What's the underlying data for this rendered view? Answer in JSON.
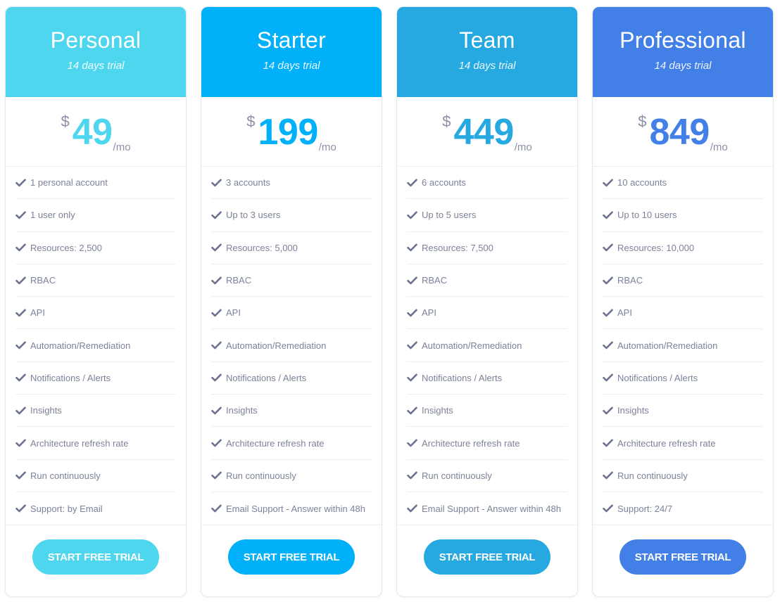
{
  "plans": [
    {
      "name": "Personal",
      "trial": "14 days trial",
      "currency": "$",
      "price": "49",
      "period": "/mo",
      "color": "#4dd6ee",
      "features": [
        "1 personal account",
        "1 user only",
        "Resources: 2,500",
        "RBAC",
        "API",
        "Automation/Remediation",
        "Notifications / Alerts",
        "Insights",
        "Architecture refresh rate",
        "Run continuously",
        "Support: by Email"
      ],
      "cta": "START FREE TRIAL"
    },
    {
      "name": "Starter",
      "trial": "14 days trial",
      "currency": "$",
      "price": "199",
      "period": "/mo",
      "color": "#00b0f8",
      "features": [
        "3 accounts",
        "Up to 3 users",
        "Resources: 5,000",
        "RBAC",
        "API",
        "Automation/Remediation",
        "Notifications / Alerts",
        "Insights",
        "Architecture refresh rate",
        "Run continuously",
        "Email Support - Answer within 48h"
      ],
      "cta": "START FREE TRIAL"
    },
    {
      "name": "Team",
      "trial": "14 days trial",
      "currency": "$",
      "price": "449",
      "period": "/mo",
      "color": "#26a8e0",
      "features": [
        "6 accounts",
        "Up to 5 users",
        "Resources: 7,500",
        "RBAC",
        "API",
        "Automation/Remediation",
        "Notifications / Alerts",
        "Insights",
        "Architecture refresh rate",
        "Run continuously",
        "Email Support - Answer within 48h"
      ],
      "cta": "START FREE TRIAL"
    },
    {
      "name": "Professional",
      "trial": "14 days trial",
      "currency": "$",
      "price": "849",
      "period": "/mo",
      "color": "#4280e8",
      "features": [
        "10 accounts",
        "Up to 10 users",
        "Resources: 10,000",
        "RBAC",
        "API",
        "Automation/Remediation",
        "Notifications / Alerts",
        "Insights",
        "Architecture refresh rate",
        "Run continuously",
        "Support: 24/7"
      ],
      "cta": "START FREE TRIAL"
    }
  ],
  "icons": {
    "feature": "check-icon"
  },
  "colors": {
    "check": "#6b7290",
    "muted": "#8b90a6",
    "feature_text": "#7c8299"
  }
}
